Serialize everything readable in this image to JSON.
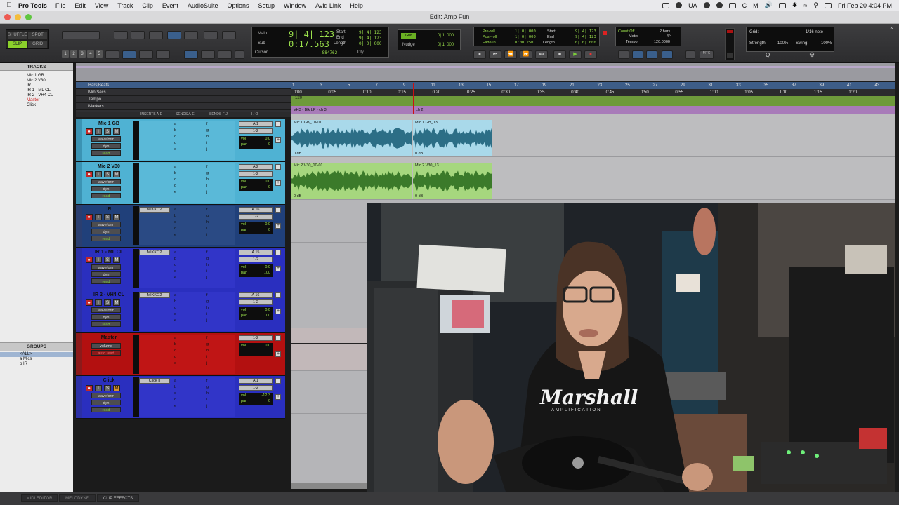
{
  "menubar": {
    "app": "Pro Tools",
    "items": [
      "File",
      "Edit",
      "View",
      "Track",
      "Clip",
      "Event",
      "AudioSuite",
      "Options",
      "Setup",
      "Window",
      "Avid Link",
      "Help"
    ],
    "lang": "UA",
    "datetime": "Fri Feb 20  4:04 PM"
  },
  "window": {
    "title": "Edit: Amp Fun"
  },
  "toolbar": {
    "modes": [
      "SHUFFLE",
      "SPOT",
      "SLIP",
      "GRID"
    ],
    "zoom_presets": [
      "1",
      "2",
      "3",
      "4",
      "5"
    ]
  },
  "counter": {
    "main_label": "Main",
    "main_value": "9| 4| 123",
    "sub_label": "Sub",
    "sub_value": "0:17.563",
    "start_label": "Start",
    "end_label": "End",
    "length_label": "Length",
    "start_value": "9| 4| 123",
    "end_value": "9| 4| 123",
    "length_value": "0| 0| 000",
    "cursor_label": "Cursor",
    "cursor_value": "-884762",
    "dly_label": "Dly"
  },
  "grid": {
    "grid_label": "Grid",
    "grid_value": "0| 1| 000",
    "nudge_label": "Nudge",
    "nudge_value": "0| 1| 000"
  },
  "transport_panel": {
    "preroll_label": "Pre-roll",
    "postroll_label": "Post-roll",
    "fadein_label": "Fade-in",
    "preroll_value": "1| 0| 000",
    "postroll_value": "1| 0| 000",
    "fadein_value": "0:00.250",
    "start_label": "Start",
    "end_label": "End",
    "length_label": "Length",
    "start_value": "9| 4| 123",
    "end_value": "9| 4| 123",
    "length_value": "0| 0| 000"
  },
  "tempo_panel": {
    "count_off": "Count Off",
    "meter_label": "Meter",
    "tempo_label": "Tempo",
    "bars_value": "2 bars",
    "meter_value": "4/4",
    "tempo_value": "120.0000"
  },
  "grid_panel": {
    "grid_label": "Grid:",
    "grid_value": "1/16 note",
    "strength_label": "Strength:",
    "strength_value": "100%",
    "swing_label": "Swing:",
    "swing_value": "100%"
  },
  "rulers": {
    "rows": [
      "Bars|Beats",
      "Min:Secs",
      "Tempo",
      "Markers"
    ],
    "bar_ticks": [
      "1",
      "3",
      "5",
      "7",
      "9",
      "11",
      "13",
      "15",
      "17",
      "19",
      "21",
      "23",
      "25",
      "27",
      "29",
      "31",
      "33",
      "35",
      "37",
      "39",
      "41",
      "43"
    ],
    "sec_ticks": [
      "0:00",
      "0:05",
      "0:10",
      "0:15",
      "0:20",
      "0:25",
      "0:30",
      "0:35",
      "0:40",
      "0:45",
      "0:50",
      "0:55",
      "1:00",
      "1:05",
      "1:10",
      "1:15",
      "1:20"
    ],
    "tempo_value": "120",
    "marker1": "VH3 - Blk LP - ch 3",
    "marker2": "ch 2"
  },
  "tracks_panel": {
    "title": "TRACKS",
    "items": [
      "Mic 1 GB",
      "Mic 2 V30",
      "IR",
      "IR 1 - ML CL",
      "IR 2 - VH4 CL",
      "Master",
      "Click"
    ]
  },
  "groups_panel": {
    "title": "GROUPS",
    "items": [
      "<ALL>",
      "a  Mics",
      "b  IR"
    ]
  },
  "columns": [
    "INSERTS A-E",
    "SENDS A-E",
    "SENDS F-J",
    "I / O"
  ],
  "tracks": [
    {
      "name": "Mic 1 GB",
      "view": "waveform",
      "dyn": "dyn",
      "auto": "read",
      "insert": "",
      "io1": "A 1",
      "io2": "1-2",
      "vol": "0.0",
      "pan": "0",
      "pan_label": "pan",
      "vol_label": "vol"
    },
    {
      "name": "Mic 2 V30",
      "view": "waveform",
      "dyn": "dyn",
      "auto": "read",
      "insert": "",
      "io1": "A 2",
      "io2": "1-2",
      "vol": "0.0",
      "pan": "0",
      "pan_label": "pan",
      "vol_label": "vol"
    },
    {
      "name": "IR",
      "view": "waveform",
      "dyn": "dyn",
      "auto": "read",
      "insert": "MIKKO2",
      "io1": "A 16",
      "io2": "1-2",
      "vol": "0.0",
      "pan": "0",
      "pan_label": "pan",
      "vol_label": "vol"
    },
    {
      "name": "IR 1 - ML CL",
      "view": "waveform",
      "dyn": "dyn",
      "auto": "read",
      "insert": "MIKKO2",
      "io1": "A 15",
      "io2": "1-2",
      "vol": "0.0",
      "pan": "100",
      "pan_label": "pan",
      "vol_label": "vol"
    },
    {
      "name": "IR 2 - VH4 CL",
      "view": "waveform",
      "dyn": "dyn",
      "auto": "read",
      "insert": "MIKKO2",
      "io1": "A 16",
      "io2": "1-2",
      "vol": "0.0",
      "pan": "100",
      "pan_label": "pan",
      "vol_label": "vol"
    },
    {
      "name": "Master",
      "view": "volume",
      "auto": "auto read",
      "io1": "1-2",
      "vol": "0.0",
      "vol_label": "vol"
    },
    {
      "name": "Click",
      "view": "waveform",
      "dyn": "dyn",
      "auto": "read",
      "insert": "Click II",
      "io1": "A 1",
      "io2": "1-2",
      "vol": "-12.3",
      "pan": "0",
      "pan_label": "pan",
      "vol_label": "vol"
    }
  ],
  "send_letters": {
    "a": [
      "a",
      "b",
      "c",
      "d",
      "e"
    ],
    "f": [
      "f",
      "g",
      "h",
      "i",
      "j"
    ]
  },
  "clips": [
    {
      "name": "Mic 1 GB_10-01",
      "gain": "0 dB"
    },
    {
      "name": "Mic 1 GB_13",
      "gain": "0 dB"
    },
    {
      "name": "Mic 2 V30_10-01",
      "gain": "0 dB"
    },
    {
      "name": "Mic 2 V30_13",
      "gain": "0 dB"
    }
  ],
  "video": {
    "shirt_text": "Marshall",
    "shirt_sub": "AMPLIFICATION"
  },
  "bottom_tabs": [
    "MIDI EDITOR",
    "MELODYNE",
    "CLIP EFFECTS"
  ],
  "colors": {
    "counter_green": "#9be04c",
    "track_cyan": "#4fb2d3",
    "track_navy": "#20407a",
    "track_blue": "#2a2fbf",
    "track_red": "#b31010",
    "clip_blue": "#a9d9ea",
    "clip_green": "#a6d77e"
  }
}
